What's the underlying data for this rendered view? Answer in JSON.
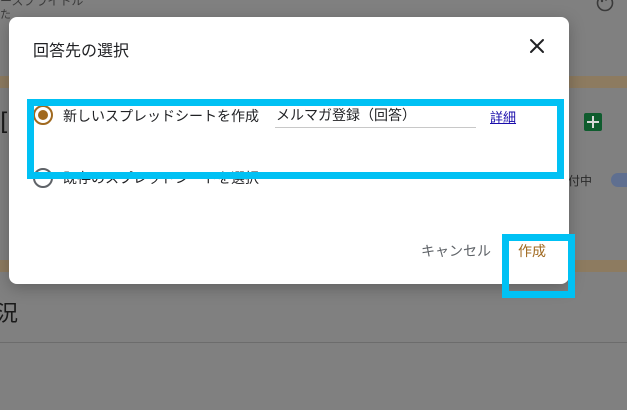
{
  "background": {
    "top_text_1": "ースプライトル",
    "top_text_2": "た",
    "accepting_label": "付中",
    "bracket_char": "[",
    "left_char": "況",
    "sheets_icon": "google-sheets-icon",
    "palette_icon": "palette-icon"
  },
  "dialog": {
    "title": "回答先の選択",
    "close_icon": "close-icon",
    "options": {
      "new_sheet": {
        "label": "新しいスプレッドシートを作成",
        "selected": true,
        "name_value": "メルマガ登録（回答）",
        "details_link": "詳細"
      },
      "existing_sheet": {
        "label": "既存のスプレッドシートを選択",
        "selected": false
      }
    },
    "actions": {
      "cancel": "キャンセル",
      "create": "作成"
    }
  },
  "colors": {
    "accent": "#a0691f",
    "highlight": "#00c1f4",
    "link": "#1a0dab",
    "overlay": "#808080"
  }
}
